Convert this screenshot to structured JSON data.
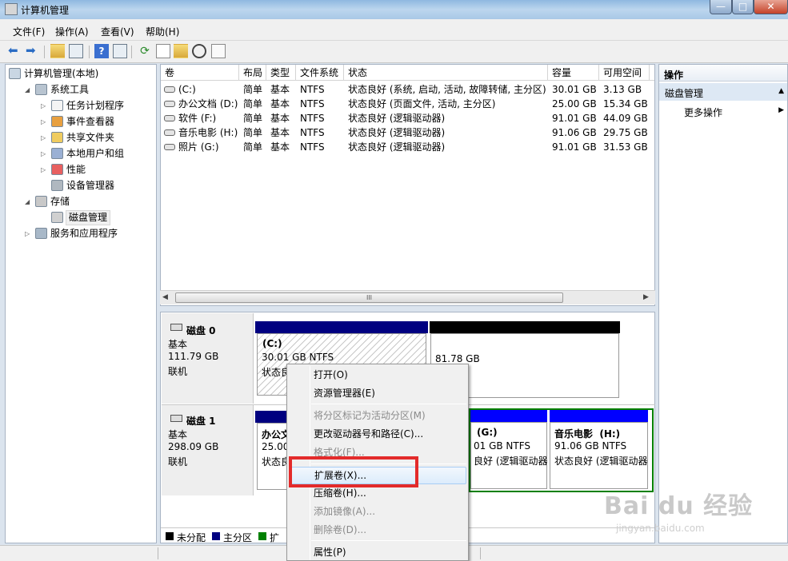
{
  "window": {
    "title": "计算机管理",
    "min": "—",
    "max": "□",
    "close": "✕"
  },
  "menu": [
    "文件(F)",
    "操作(A)",
    "查看(V)",
    "帮助(H)"
  ],
  "tree": [
    {
      "label": "计算机管理(本地)",
      "level": 0,
      "expand": "",
      "icon": "computer-icon"
    },
    {
      "label": "系统工具",
      "level": 1,
      "expand": "◢",
      "icon": "tools-icon"
    },
    {
      "label": "任务计划程序",
      "level": 2,
      "expand": "▷",
      "icon": "clock-icon"
    },
    {
      "label": "事件查看器",
      "level": 2,
      "expand": "▷",
      "icon": "event-viewer-icon"
    },
    {
      "label": "共享文件夹",
      "level": 2,
      "expand": "▷",
      "icon": "shared-folder-icon"
    },
    {
      "label": "本地用户和组",
      "level": 2,
      "expand": "▷",
      "icon": "users-icon"
    },
    {
      "label": "性能",
      "level": 2,
      "expand": "▷",
      "icon": "performance-icon"
    },
    {
      "label": "设备管理器",
      "level": 2,
      "expand": "",
      "icon": "device-manager-icon"
    },
    {
      "label": "存储",
      "level": 1,
      "expand": "◢",
      "icon": "storage-icon"
    },
    {
      "label": "磁盘管理",
      "level": 2,
      "expand": "",
      "icon": "disk-management-icon"
    },
    {
      "label": "服务和应用程序",
      "level": 1,
      "expand": "▷",
      "icon": "services-icon"
    }
  ],
  "columns": [
    "卷",
    "布局",
    "类型",
    "文件系统",
    "状态",
    "容量",
    "可用空间"
  ],
  "volumes": [
    {
      "name": "(C:)",
      "layout": "简单",
      "type": "基本",
      "fs": "NTFS",
      "status": "状态良好 (系统, 启动, 活动, 故障转储, 主分区)",
      "capacity": "30.01 GB",
      "free": "3.13 GB"
    },
    {
      "name": "办公文档 (D:)",
      "layout": "简单",
      "type": "基本",
      "fs": "NTFS",
      "status": "状态良好 (页面文件, 活动, 主分区)",
      "capacity": "25.00 GB",
      "free": "15.34 GB"
    },
    {
      "name": "软件 (F:)",
      "layout": "简单",
      "type": "基本",
      "fs": "NTFS",
      "status": "状态良好 (逻辑驱动器)",
      "capacity": "91.01 GB",
      "free": "44.09 GB"
    },
    {
      "name": "音乐电影 (H:)",
      "layout": "简单",
      "type": "基本",
      "fs": "NTFS",
      "status": "状态良好 (逻辑驱动器)",
      "capacity": "91.06 GB",
      "free": "29.75 GB"
    },
    {
      "name": "照片 (G:)",
      "layout": "简单",
      "type": "基本",
      "fs": "NTFS",
      "status": "状态良好 (逻辑驱动器)",
      "capacity": "91.01 GB",
      "free": "31.53 GB"
    }
  ],
  "scroll_grip": "III",
  "disks": [
    {
      "name": "磁盘 0",
      "type": "基本",
      "size": "111.79 GB",
      "status": "联机",
      "c_label": "(C:)",
      "c_size": "30.01 GB NTFS",
      "c_status": "状态良",
      "unalloc_size": "81.78 GB"
    },
    {
      "name": "磁盘 1",
      "type": "基本",
      "size": "298.09 GB",
      "status": "联机",
      "d_label": "办公文",
      "d_size": "25.00",
      "d_status": "状态良",
      "g_label": "(G:)",
      "g_size": "01 GB NTFS",
      "g_status": "良好 (逻辑驱动器",
      "h_label": "音乐电影  (H:)",
      "h_size": "91.06 GB NTFS",
      "h_status": "状态良好 (逻辑驱动器"
    }
  ],
  "legend": [
    {
      "label": "未分配",
      "color": "#000000"
    },
    {
      "label": "主分区",
      "color": "#000080"
    },
    {
      "label": "扩",
      "color": "#008000"
    }
  ],
  "actions": {
    "header": "操作",
    "section": "磁盘管理",
    "more": "更多操作",
    "section_arrow": "▲",
    "more_arrow": "▶"
  },
  "context_menu": [
    {
      "label": "打开(O)",
      "enabled": true
    },
    {
      "label": "资源管理器(E)",
      "enabled": true
    },
    {
      "sep": true
    },
    {
      "label": "将分区标记为活动分区(M)",
      "enabled": false
    },
    {
      "label": "更改驱动器号和路径(C)...",
      "enabled": true
    },
    {
      "label": "格式化(F)...",
      "enabled": false
    },
    {
      "sep": true
    },
    {
      "label": "扩展卷(X)...",
      "enabled": true
    },
    {
      "label": "压缩卷(H)...",
      "enabled": true
    },
    {
      "label": "添加镜像(A)...",
      "enabled": false
    },
    {
      "label": "删除卷(D)...",
      "enabled": false
    },
    {
      "sep": true
    },
    {
      "label": "属性(P)",
      "enabled": true
    }
  ],
  "watermark": {
    "main": "Bai du 经验",
    "sub": "jingyan.baidu.com"
  },
  "colors": {
    "primary": "#000080",
    "extended": "#008000",
    "unallocated": "#000000",
    "highlight": "#e32b2b",
    "selection": "#dcecfc"
  }
}
